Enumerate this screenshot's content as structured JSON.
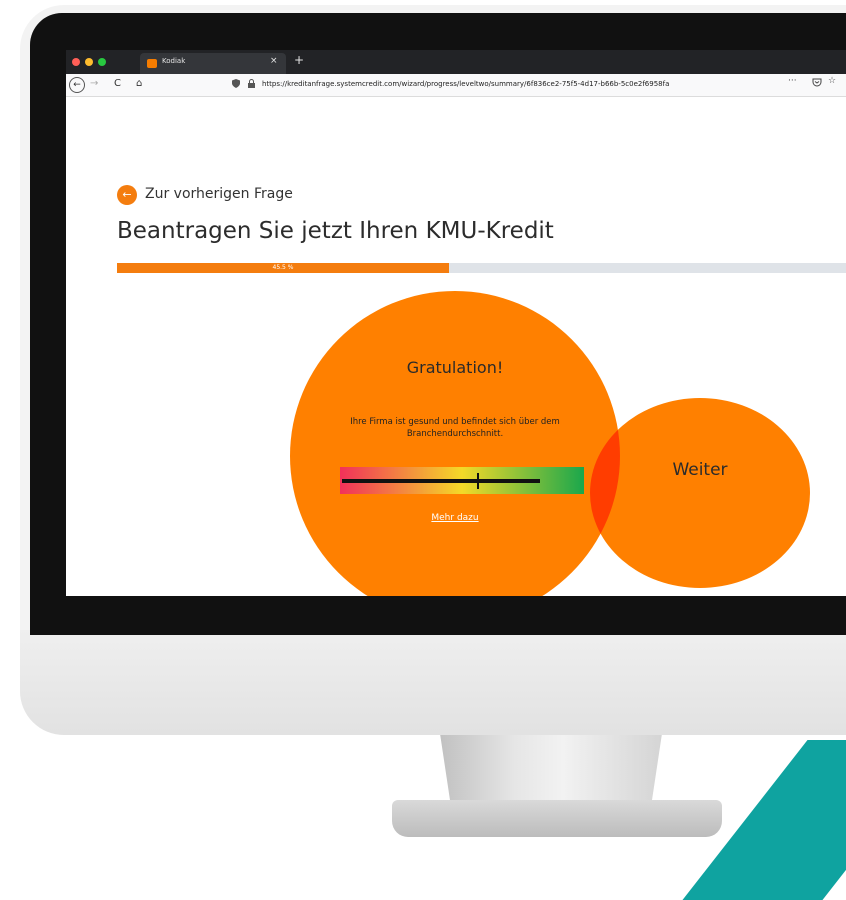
{
  "browser": {
    "tab_title": "Kodiak",
    "tab_close": "×",
    "tab_new": "+",
    "url": "https://kreditanfrage.systemcredit.com/wizard/progress/leveltwo/summary/6f836ce2-75f5-4d17-b66b-5c0e2f6958fa",
    "url_more": "···",
    "nav": {
      "back": "←",
      "forward": "→",
      "reload": "C",
      "home": "⌂"
    },
    "icons": {
      "shield": "shield-icon",
      "lock": "lock-icon",
      "pocket": "pocket-icon",
      "bookmark": "star-icon"
    }
  },
  "page": {
    "back_label": "Zur vorherigen Frage",
    "back_arrow": "←",
    "title": "Beantragen Sie jetzt Ihren KMU-Kredit",
    "progress": {
      "value": 45.5,
      "label": "45.5 %"
    }
  },
  "result": {
    "title": "Gratulation!",
    "text": "Ihre Firma ist gesund und befindet sich über dem Branchendurchschnitt.",
    "meter": {
      "value": 0.56
    },
    "link": "Mehr dazu"
  },
  "next": {
    "label": "Weiter"
  },
  "colors": {
    "accent": "#ff8000",
    "overlap": "#ff3d00",
    "teal": "#0fa3a0"
  }
}
